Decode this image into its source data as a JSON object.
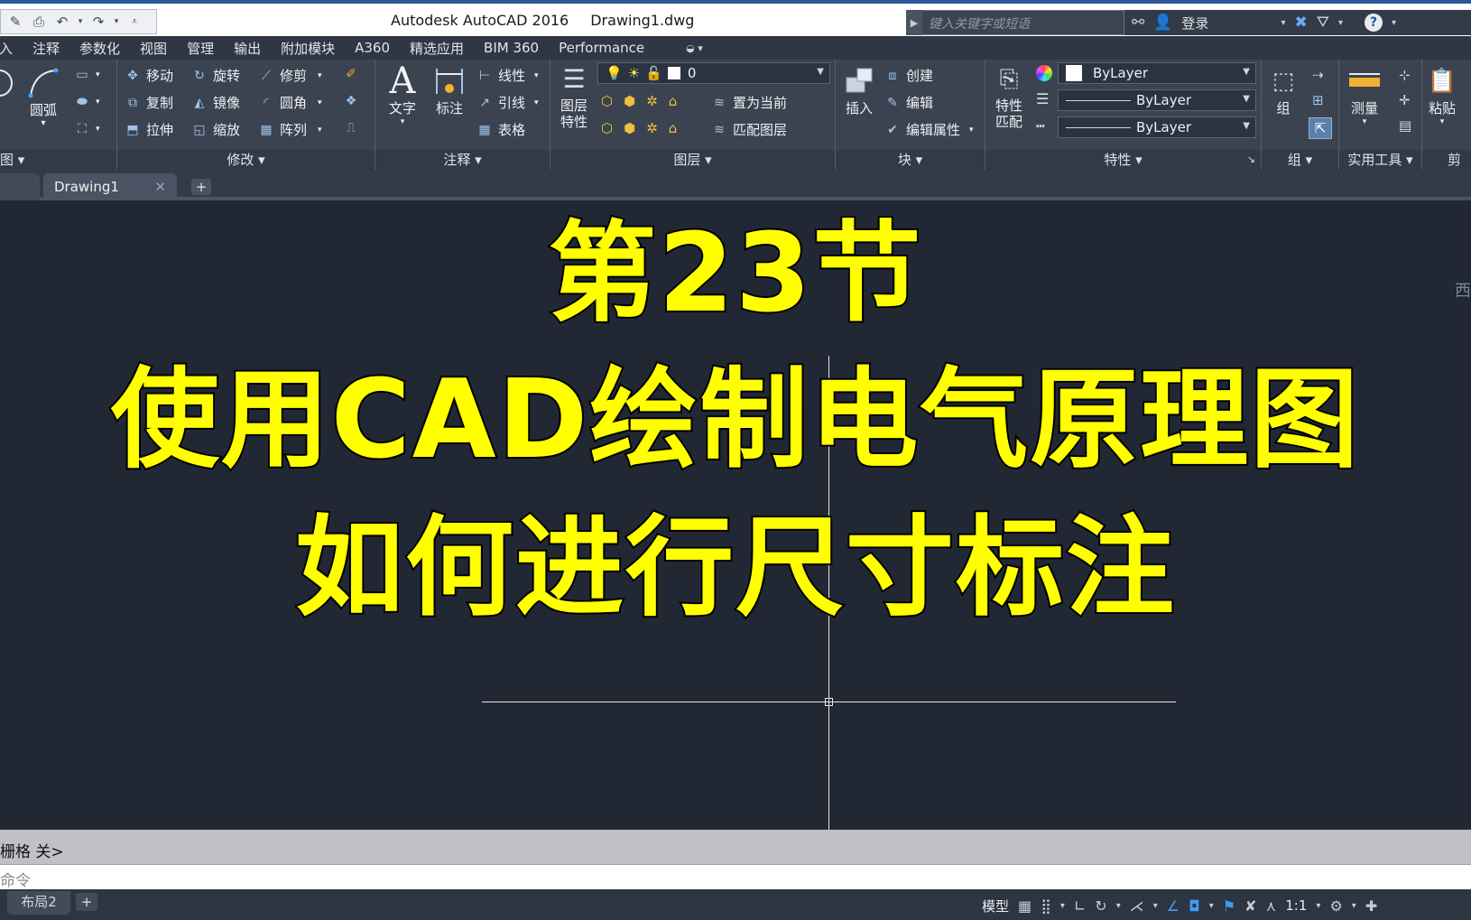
{
  "window": {
    "app_title": "Autodesk AutoCAD 2016",
    "file_title": "Drawing1.dwg",
    "search_placeholder": "键入关键字或短语",
    "login_label": "登录",
    "help_label": "?"
  },
  "menu": [
    "插入",
    "注释",
    "参数化",
    "视图",
    "管理",
    "输出",
    "附加模块",
    "A360",
    "精选应用",
    "BIM 360",
    "Performance"
  ],
  "ribbon": {
    "draw_panel": {
      "arc_label": "圆弧",
      "title": "图"
    },
    "modify_panel": {
      "title": "修改",
      "move": "移动",
      "rotate": "旋转",
      "trim": "修剪",
      "copy": "复制",
      "mirror": "镜像",
      "fillet": "圆角",
      "stretch": "拉伸",
      "scale": "缩放",
      "array": "阵列"
    },
    "annotation_panel": {
      "title": "注释",
      "text": "文字",
      "dimension": "标注",
      "linear": "线性",
      "leader": "引线",
      "table": "表格"
    },
    "layers_panel": {
      "title": "图层",
      "layer_props_1": "图层",
      "layer_props_2": "特性",
      "current_layer": "0",
      "set_current": "置为当前",
      "match_layer": "匹配图层"
    },
    "block_panel": {
      "title": "块",
      "insert": "插入",
      "create": "创建",
      "edit": "编辑",
      "edit_attr": "编辑属性"
    },
    "properties_panel": {
      "title": "特性",
      "match_1": "特性",
      "match_2": "匹配",
      "color": "ByLayer",
      "linetype": "ByLayer",
      "lineweight": "ByLayer"
    },
    "group_panel": {
      "title": "组",
      "group": "组"
    },
    "utilities_panel": {
      "title": "实用工具",
      "measure": "测量"
    },
    "clipboard_panel": {
      "title": "剪贴",
      "paste": "粘贴"
    }
  },
  "tabs": {
    "drawing": "Drawing1",
    "close": "✕",
    "new": "+"
  },
  "canvas": {
    "line1": "第23节",
    "line2": "使用CAD绘制电气原理图",
    "line3": "如何进行尺寸标注",
    "viewcube_label": "西"
  },
  "command": {
    "history": "栅格 关>",
    "prompt": "命令"
  },
  "layout": {
    "tab": "布局2",
    "plus": "+"
  },
  "status": {
    "model": "模型",
    "scale": "1:1"
  }
}
